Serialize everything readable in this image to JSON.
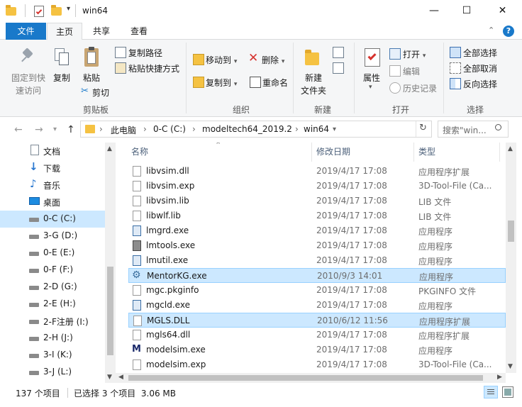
{
  "window": {
    "title": "win64",
    "minimize": "—",
    "maximize": "☐",
    "close": "✕"
  },
  "ribbon_tabs": [
    {
      "label": "文件"
    },
    {
      "label": "主页"
    },
    {
      "label": "共享"
    },
    {
      "label": "查看"
    }
  ],
  "ribbon": {
    "clipboard": {
      "pin": "固定到快\n速访问",
      "copy": "复制",
      "paste": "粘贴",
      "copy_path": "复制路径",
      "paste_shortcut": "粘贴快捷方式",
      "cut": "剪切",
      "group": "剪贴板"
    },
    "organize": {
      "move_to": "移动到",
      "copy_to": "复制到",
      "delete": "删除",
      "rename": "重命名",
      "group": "组织"
    },
    "new": {
      "new_folder": "新建\n文件夹",
      "group": "新建"
    },
    "open": {
      "properties": "属性",
      "open": "打开",
      "edit": "编辑",
      "history": "历史记录",
      "group": "打开"
    },
    "select": {
      "select_all": "全部选择",
      "select_none": "全部取消",
      "invert": "反向选择",
      "group": "选择"
    }
  },
  "address": {
    "crumbs": [
      "此电脑",
      "0-C (C:)",
      "modeltech64_2019.2",
      "win64"
    ],
    "search_placeholder": "搜索\"win..."
  },
  "nav_pane": [
    {
      "label": "文档",
      "icon": "document-icon"
    },
    {
      "label": "下载",
      "icon": "download-icon"
    },
    {
      "label": "音乐",
      "icon": "music-icon"
    },
    {
      "label": "桌面",
      "icon": "desktop-icon"
    },
    {
      "label": "0-C (C:)",
      "icon": "drive-icon",
      "selected": true
    },
    {
      "label": "3-G (D:)",
      "icon": "drive-icon"
    },
    {
      "label": "0-E (E:)",
      "icon": "drive-icon"
    },
    {
      "label": "0-F (F:)",
      "icon": "drive-icon"
    },
    {
      "label": "2-D (G:)",
      "icon": "drive-icon"
    },
    {
      "label": "2-E (H:)",
      "icon": "drive-icon"
    },
    {
      "label": "2-F注册 (I:)",
      "icon": "drive-icon"
    },
    {
      "label": "2-H (J:)",
      "icon": "drive-icon"
    },
    {
      "label": "3-I (K:)",
      "icon": "drive-icon"
    },
    {
      "label": "3-J (L:)",
      "icon": "drive-icon"
    }
  ],
  "columns": {
    "name": "名称",
    "date": "修改日期",
    "type": "类型"
  },
  "files": [
    {
      "name": "libvsim.dll",
      "date": "2019/4/17 17:08",
      "type": "应用程序扩展",
      "icon": "dll-icon"
    },
    {
      "name": "libvsim.exp",
      "date": "2019/4/17 17:08",
      "type": "3D-Tool-File (Ca...",
      "icon": "file-icon"
    },
    {
      "name": "libvsim.lib",
      "date": "2019/4/17 17:08",
      "type": "LIB 文件",
      "icon": "file-icon"
    },
    {
      "name": "libwlf.lib",
      "date": "2019/4/17 17:08",
      "type": "LIB 文件",
      "icon": "file-icon"
    },
    {
      "name": "lmgrd.exe",
      "date": "2019/4/17 17:08",
      "type": "应用程序",
      "icon": "exe-icon"
    },
    {
      "name": "lmtools.exe",
      "date": "2019/4/17 17:08",
      "type": "应用程序",
      "icon": "tools-icon"
    },
    {
      "name": "lmutil.exe",
      "date": "2019/4/17 17:08",
      "type": "应用程序",
      "icon": "exe-icon"
    },
    {
      "name": "MentorKG.exe",
      "date": "2010/9/3 14:01",
      "type": "应用程序",
      "icon": "gear-icon",
      "selected": true
    },
    {
      "name": "mgc.pkginfo",
      "date": "2019/4/17 17:08",
      "type": "PKGINFO 文件",
      "icon": "file-icon"
    },
    {
      "name": "mgcld.exe",
      "date": "2019/4/17 17:08",
      "type": "应用程序",
      "icon": "exe-icon"
    },
    {
      "name": "MGLS.DLL",
      "date": "2010/6/12 11:56",
      "type": "应用程序扩展",
      "icon": "dll-icon",
      "selected": true
    },
    {
      "name": "mgls64.dll",
      "date": "2019/4/17 17:08",
      "type": "应用程序扩展",
      "icon": "dll-icon"
    },
    {
      "name": "modelsim.exe",
      "date": "2019/4/17 17:08",
      "type": "应用程序",
      "icon": "modelsim-icon"
    },
    {
      "name": "modelsim.exp",
      "date": "2019/4/17 17:08",
      "type": "3D-Tool-File (Ca...",
      "icon": "file-icon"
    }
  ],
  "status": {
    "count": "137 个项目",
    "selected": "已选择 3 个项目  3.06 MB"
  },
  "colors": {
    "accent": "#1979ca",
    "selection": "#cce8ff",
    "selection_border": "#99d1ff"
  }
}
